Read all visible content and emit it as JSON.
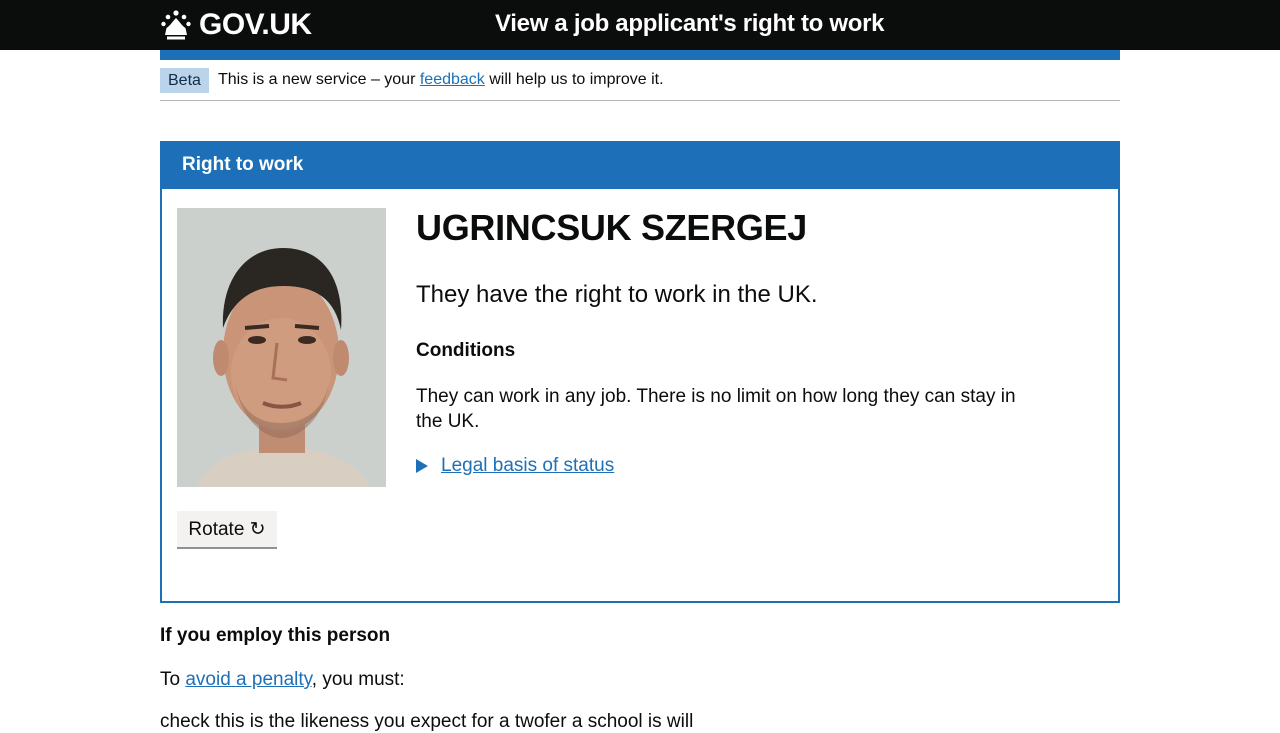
{
  "header": {
    "logo_text": "GOV.UK",
    "service_name": "View a job applicant's right to work"
  },
  "phase_banner": {
    "tag": "Beta",
    "text_before": "This is a new service – your ",
    "link": "feedback",
    "text_after": " will help us to improve it."
  },
  "panel": {
    "title": "Right to work",
    "name": "UGRINCSUK SZERGEJ",
    "status": "They have the right to work in the UK.",
    "conditions_heading": "Conditions",
    "conditions_text": "They can work in any job. There is no limit on how long they can stay in the UK.",
    "details_link": "Legal basis of status",
    "rotate_button": "Rotate ↻"
  },
  "employ": {
    "heading": "If you employ this person",
    "penalty_before": "To ",
    "penalty_link": "avoid a penalty",
    "penalty_after": ", you must:",
    "partial_item": "check this is the likeness you expect for a twofer a school is will"
  },
  "colors": {
    "header_bg": "#0b0c0c",
    "brand_blue": "#1d70b8",
    "tag_bg": "#bbd4ea",
    "button_bg": "#f3f2f1"
  }
}
